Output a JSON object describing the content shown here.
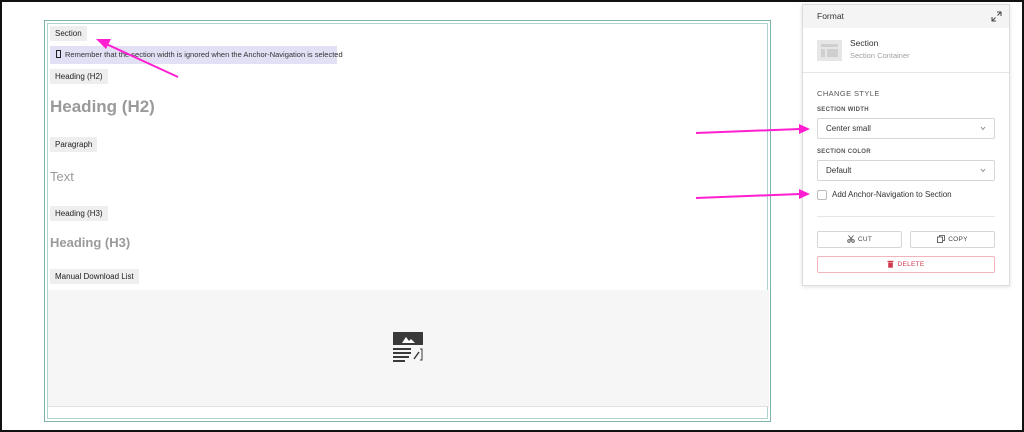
{
  "editor": {
    "section_tag": "Section",
    "notice_text": "Remember that the section width is ignored when the Anchor-Navigation is selected",
    "heading_h2_tag": "Heading (H2)",
    "heading_h2_text": "Heading (H2)",
    "paragraph_tag": "Paragraph",
    "paragraph_text": "Text",
    "heading_h3_tag": "Heading (H3)",
    "heading_h3_text": "Heading (H3)",
    "download_list_tag": "Manual Download List",
    "placeholder_icon": "image-document-placeholder-icon"
  },
  "panel": {
    "title": "Format",
    "collapse_icon": "collapse-arrows-icon",
    "element_name": "Section",
    "element_type": "Section Container",
    "change_style_label": "CHANGE STYLE",
    "section_width": {
      "label": "SECTION WIDTH",
      "value": "Center small"
    },
    "section_color": {
      "label": "SECTION COLOR",
      "value": "Default"
    },
    "anchor_nav": {
      "label": "Add Anchor-Navigation to Section",
      "checked": false
    },
    "cut_label": "CUT",
    "copy_label": "COPY",
    "delete_label": "DELETE"
  },
  "colors": {
    "annotation_arrow": "#ff1fd1",
    "delete": "#d0394e",
    "notice_bg": "#e2e0f5",
    "editor_border": "#7fb4ad"
  }
}
